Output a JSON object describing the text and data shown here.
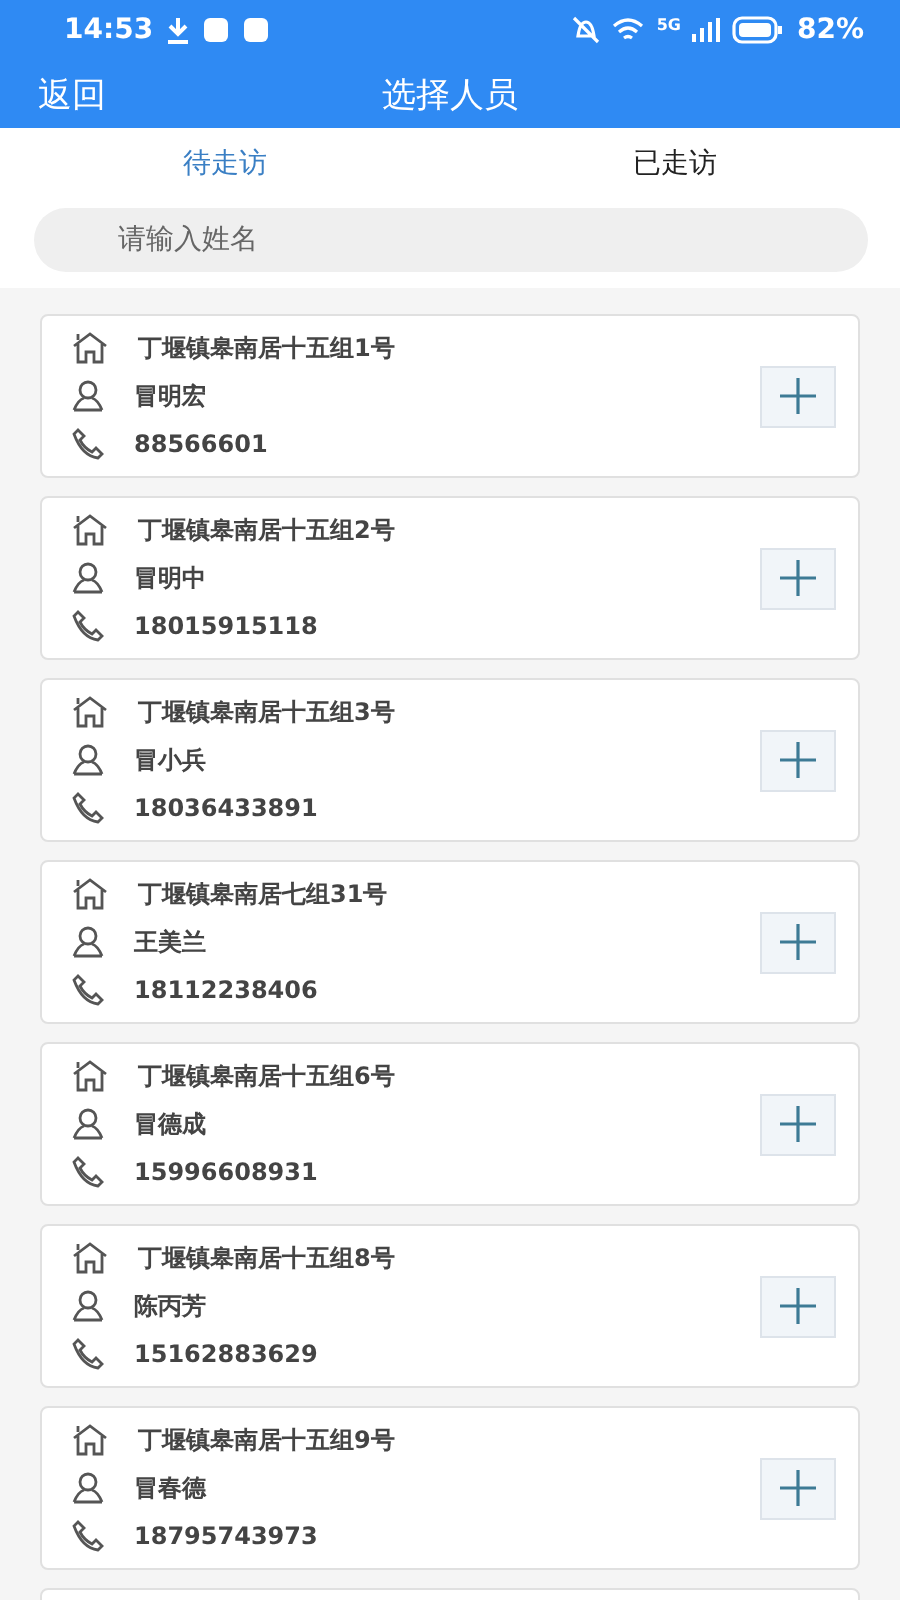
{
  "status_bar": {
    "time": "14:53",
    "network": "5G",
    "battery": "82%"
  },
  "header": {
    "back": "返回",
    "title": "选择人员"
  },
  "tabs": [
    {
      "label": "待走访",
      "selected": true
    },
    {
      "label": "已走访",
      "selected": false
    }
  ],
  "search": {
    "placeholder": "请输入姓名"
  },
  "people": [
    {
      "address": "丁堰镇皋南居十五组1号",
      "name": "冒明宏",
      "phone": "88566601"
    },
    {
      "address": "丁堰镇皋南居十五组2号",
      "name": "冒明中",
      "phone": "18015915118"
    },
    {
      "address": "丁堰镇皋南居十五组3号",
      "name": "冒小兵",
      "phone": "18036433891"
    },
    {
      "address": "丁堰镇皋南居七组31号",
      "name": "王美兰",
      "phone": "18112238406"
    },
    {
      "address": "丁堰镇皋南居十五组6号",
      "name": "冒德成",
      "phone": "15996608931"
    },
    {
      "address": "丁堰镇皋南居十五组8号",
      "name": "陈丙芳",
      "phone": "15162883629"
    },
    {
      "address": "丁堰镇皋南居十五组9号",
      "name": "冒春德",
      "phone": "18795743973"
    }
  ]
}
